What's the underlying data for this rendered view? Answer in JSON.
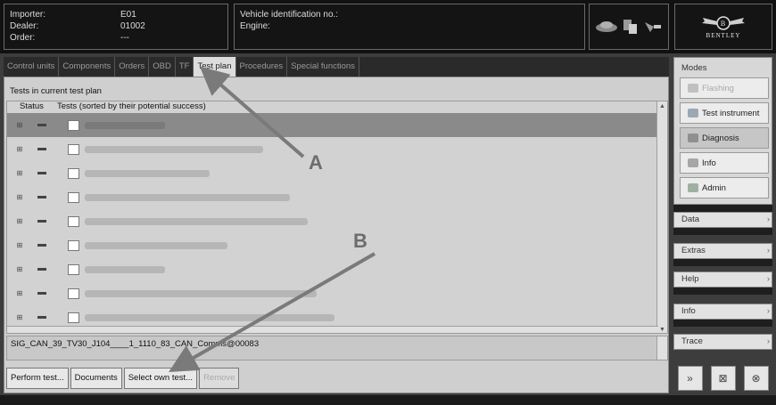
{
  "header": {
    "importer_label": "Importer:",
    "importer_value": "E01",
    "dealer_label": "Dealer:",
    "dealer_value": "01002",
    "order_label": "Order:",
    "order_value": "---",
    "vin_label": "Vehicle identification no.:",
    "engine_label": "Engine:",
    "logo_text": "BENTLEY"
  },
  "tabs": [
    {
      "label": "Control units"
    },
    {
      "label": "Components"
    },
    {
      "label": "Orders"
    },
    {
      "label": "OBD"
    },
    {
      "label": "TF"
    },
    {
      "label": "Test plan"
    },
    {
      "label": "Procedures"
    },
    {
      "label": "Special functions"
    }
  ],
  "panel": {
    "title": "Tests in current test plan",
    "col_status": "Status",
    "col_tests": "Tests (sorted by their potential success)"
  },
  "rows": [
    {
      "selected": true
    },
    {
      "selected": false
    },
    {
      "selected": false
    },
    {
      "selected": false
    },
    {
      "selected": false
    },
    {
      "selected": false
    },
    {
      "selected": false
    },
    {
      "selected": false
    },
    {
      "selected": false
    }
  ],
  "detail_text": "SIG_CAN_39_TV30_J104____1_1110_83_CAN_Comms@00083",
  "buttons": {
    "perform": "Perform test...",
    "documents": "Documents",
    "select_own": "Select own test...",
    "remove": "Remove"
  },
  "sidebar": {
    "modes_title": "Modes",
    "modes": [
      {
        "label": "Flashing",
        "state": "dim"
      },
      {
        "label": "Test instrument",
        "state": "normal"
      },
      {
        "label": "Diagnosis",
        "state": "active"
      },
      {
        "label": "Info",
        "state": "normal"
      },
      {
        "label": "Admin",
        "state": "normal"
      }
    ],
    "sections": [
      "Data",
      "Extras",
      "Help",
      "Info",
      "Trace"
    ]
  },
  "annotations": {
    "a": "A",
    "b": "B"
  }
}
